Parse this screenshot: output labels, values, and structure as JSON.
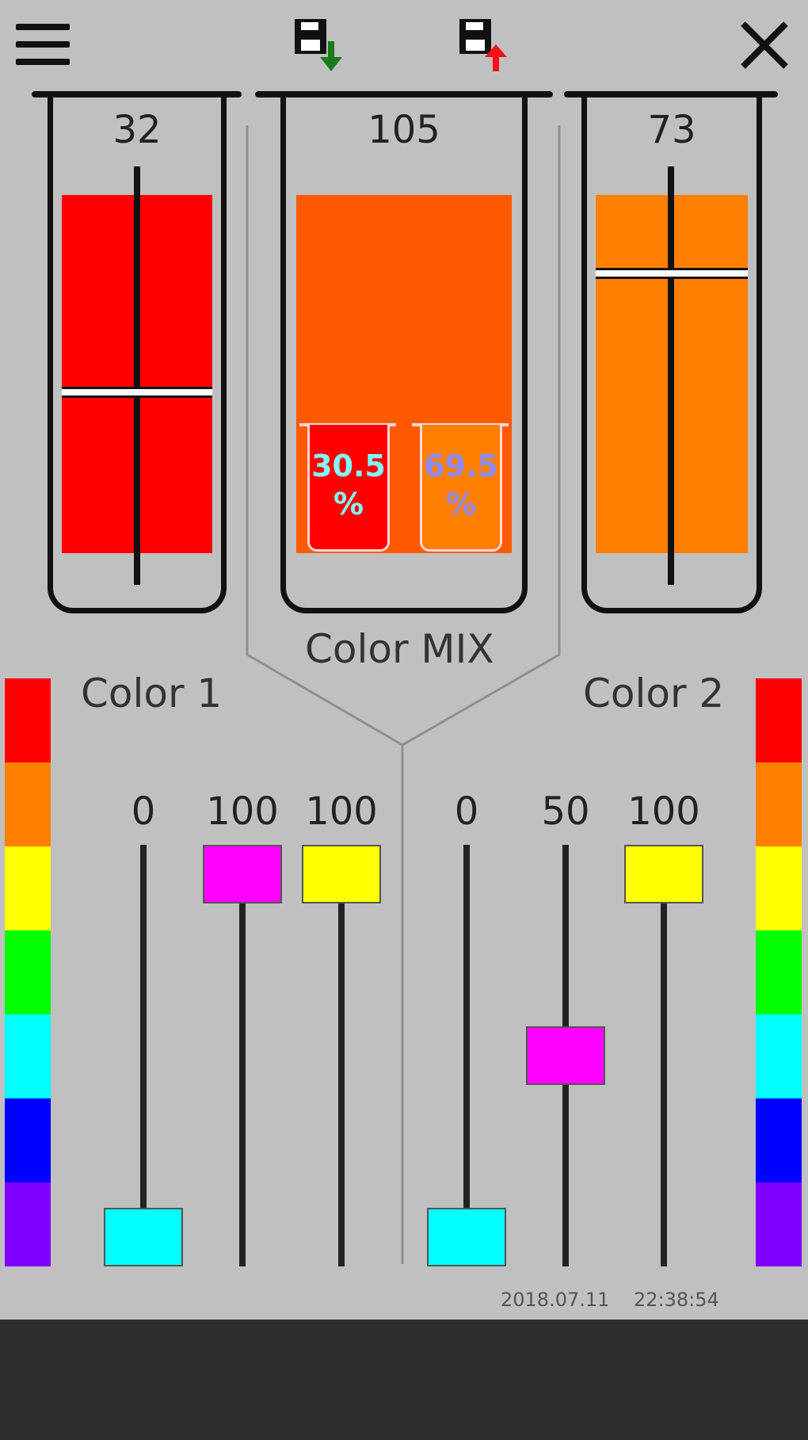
{
  "toolbar": {
    "menu_icon": "hamburger-menu-icon",
    "save_icon": "save-down-icon",
    "load_icon": "load-up-icon",
    "close_icon": "close-icon"
  },
  "beakers": {
    "color1_value": "32",
    "mix_value": "105",
    "color2_value": "73",
    "color1_level": 0.45,
    "color2_level": 0.78,
    "color1_hex": "#ff0000",
    "mix_hex": "#ff5a00",
    "color2_hex": "#ff7f00",
    "mix_percent1": "30.5",
    "mix_percent2": "69.5",
    "percent_sign": "%"
  },
  "labels": {
    "color_mix": "Color MIX",
    "color1": "Color 1",
    "color2": "Color 2"
  },
  "sliders": {
    "color1": [
      {
        "value": "0",
        "fraction": 0.0,
        "color": "#00ffff"
      },
      {
        "value": "100",
        "fraction": 1.0,
        "color": "#ff00ff"
      },
      {
        "value": "100",
        "fraction": 1.0,
        "color": "#ffff00"
      }
    ],
    "color2": [
      {
        "value": "0",
        "fraction": 0.0,
        "color": "#00ffff"
      },
      {
        "value": "50",
        "fraction": 0.5,
        "color": "#ff00ff"
      },
      {
        "value": "100",
        "fraction": 1.0,
        "color": "#ffff00"
      }
    ]
  },
  "rainbow_colors": [
    "#ff0000",
    "#ff7f00",
    "#ffff00",
    "#00ff00",
    "#00ffff",
    "#0000ff",
    "#7f00ff"
  ],
  "status": {
    "date": "2018.07.11",
    "time": "22:38:54"
  }
}
